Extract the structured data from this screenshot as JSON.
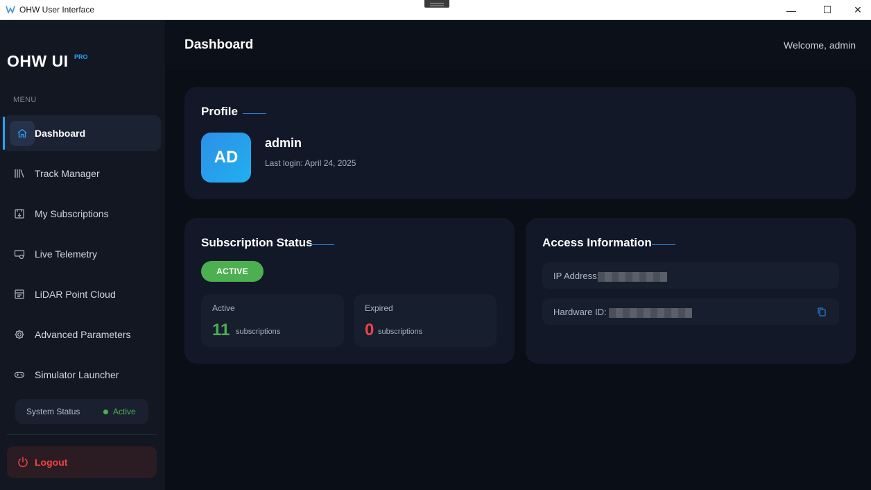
{
  "window": {
    "title": "OHW User Interface",
    "minimize_glyph": "—",
    "maximize_glyph": "☐",
    "close_glyph": "✕"
  },
  "sidebar": {
    "brand": "OHW UI",
    "brand_badge": "PRO",
    "menu_label": "MENU",
    "items": [
      {
        "label": "Dashboard",
        "icon": "home-icon",
        "active": true
      },
      {
        "label": "Track Manager",
        "icon": "library-icon",
        "active": false
      },
      {
        "label": "My Subscriptions",
        "icon": "subscription-icon",
        "active": false
      },
      {
        "label": "Live Telemetry",
        "icon": "telemetry-icon",
        "active": false
      },
      {
        "label": "LiDAR Point Cloud",
        "icon": "point-cloud-icon",
        "active": false
      },
      {
        "label": "Advanced Parameters",
        "icon": "gear-icon",
        "active": false
      },
      {
        "label": "Simulator Launcher",
        "icon": "gamepad-icon",
        "active": false
      }
    ],
    "system_status": {
      "label": "System Status",
      "value": "Active"
    },
    "logout_label": "Logout"
  },
  "header": {
    "title": "Dashboard",
    "welcome": "Welcome, admin"
  },
  "profile": {
    "title": "Profile",
    "avatar_initials": "AD",
    "username": "admin",
    "last_login": "Last login: April 24, 2025"
  },
  "subscription": {
    "title": "Subscription Status",
    "status_badge": "ACTIVE",
    "active": {
      "label": "Active",
      "count": "11",
      "unit": "subscriptions"
    },
    "expired": {
      "label": "Expired",
      "count": "0",
      "unit": "subscriptions"
    }
  },
  "access": {
    "title": "Access Information",
    "ip_label": "IP Address:",
    "hardware_label": "Hardware ID:"
  },
  "colors": {
    "accent": "#2aa3f0",
    "success": "#4caf50",
    "danger": "#ef4444",
    "background": "#0a0e17",
    "card": "#121828"
  }
}
